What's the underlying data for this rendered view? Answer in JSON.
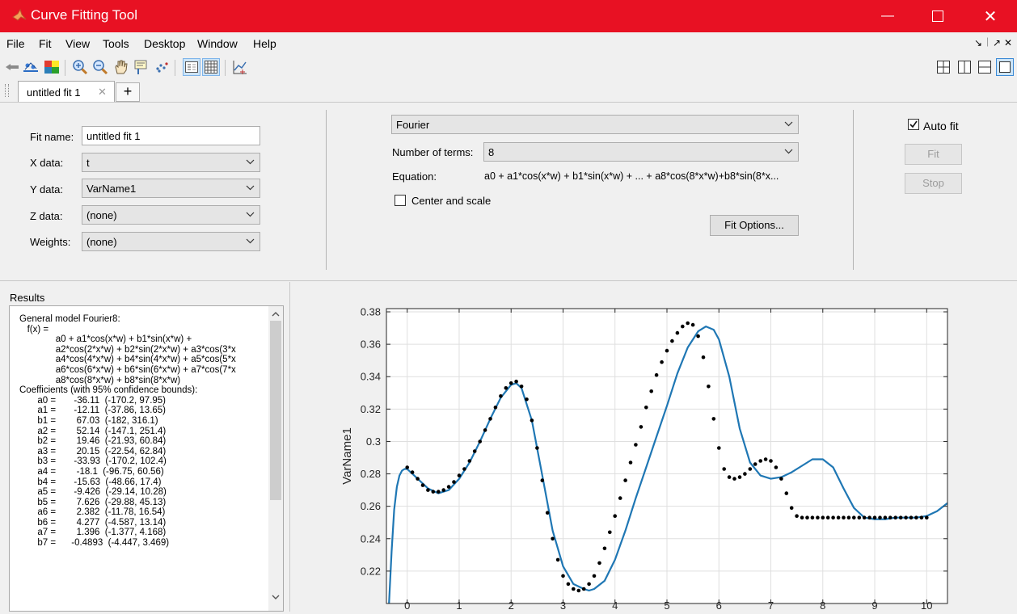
{
  "window": {
    "title": "Curve Fitting Tool"
  },
  "menu": [
    "File",
    "Fit",
    "View",
    "Tools",
    "Desktop",
    "Window",
    "Help"
  ],
  "menu_right": [
    "↘",
    "↗",
    "✕"
  ],
  "tabs": {
    "active": "untitled fit 1",
    "close": "✕",
    "add": "+"
  },
  "fit": {
    "name_label": "Fit name:",
    "name_value": "untitled fit 1",
    "x_label": "X data:",
    "x_value": "t",
    "y_label": "Y data:",
    "y_value": "VarName1",
    "z_label": "Z data:",
    "z_value": "(none)",
    "w_label": "Weights:",
    "w_value": "(none)"
  },
  "model": {
    "type": "Fourier",
    "terms_label": "Number of terms:",
    "terms_value": "8",
    "equation_label": "Equation:",
    "equation": "a0 + a1*cos(x*w) + b1*sin(x*w) + ... + a8*cos(8*x*w)+b8*sin(8*x...",
    "center_scale": "Center and scale",
    "fit_options": "Fit Options..."
  },
  "actions": {
    "auto_fit": "Auto fit",
    "fit": "Fit",
    "stop": "Stop"
  },
  "results": {
    "title": "Results",
    "lines": [
      "General model Fourier8:",
      "   f(x) =",
      "              a0 + a1*cos(x*w) + b1*sin(x*w) +",
      "              a2*cos(2*x*w) + b2*sin(2*x*w) + a3*cos(3*x",
      "              a4*cos(4*x*w) + b4*sin(4*x*w) + a5*cos(5*x",
      "              a6*cos(6*x*w) + b6*sin(6*x*w) + a7*cos(7*x",
      "              a8*cos(8*x*w) + b8*sin(8*x*w)",
      "Coefficients (with 95% confidence bounds):",
      "       a0 =       -36.11  (-170.2, 97.95)",
      "       a1 =       -12.11  (-37.86, 13.65)",
      "       b1 =        67.03  (-182, 316.1)",
      "       a2 =        52.14  (-147.1, 251.4)",
      "       b2 =        19.46  (-21.93, 60.84)",
      "       a3 =        20.15  (-22.54, 62.84)",
      "       b3 =       -33.93  (-170.2, 102.4)",
      "       a4 =        -18.1  (-96.75, 60.56)",
      "       b4 =       -15.63  (-48.66, 17.4)",
      "       a5 =       -9.426  (-29.14, 10.28)",
      "       b5 =        7.626  (-29.88, 45.13)",
      "       a6 =        2.382  (-11.78, 16.54)",
      "       b6 =        4.277  (-4.587, 13.14)",
      "       a7 =        1.396  (-1.377, 4.168)",
      "       b7 =      -0.4893  (-4.447, 3.469)"
    ]
  },
  "colors": {
    "titlebar": "#e81123",
    "fit_line": "#1f77b4",
    "points": "#000000"
  },
  "chart_data": {
    "type": "scatter",
    "title": "",
    "xlabel": "",
    "ylabel": "VarName1",
    "xlim": [
      -0.4,
      10.4
    ],
    "ylim": [
      0.2,
      0.382
    ],
    "xticks": [
      0,
      1,
      2,
      3,
      4,
      5,
      6,
      7,
      8,
      9,
      10
    ],
    "yticks": [
      0.22,
      0.24,
      0.26,
      0.28,
      0.3,
      0.32,
      0.34,
      0.36,
      0.38
    ],
    "grid": true,
    "series": [
      {
        "style": "markers",
        "x": [
          0.0,
          0.1,
          0.2,
          0.3,
          0.4,
          0.5,
          0.6,
          0.7,
          0.8,
          0.9,
          1.0,
          1.1,
          1.2,
          1.3,
          1.4,
          1.5,
          1.6,
          1.7,
          1.8,
          1.9,
          2.0,
          2.1,
          2.2,
          2.3,
          2.4,
          2.5,
          2.6,
          2.7,
          2.8,
          2.9,
          3.0,
          3.1,
          3.2,
          3.3,
          3.4,
          3.5,
          3.6,
          3.7,
          3.8,
          3.9,
          4.0,
          4.1,
          4.2,
          4.3,
          4.4,
          4.5,
          4.6,
          4.7,
          4.8,
          4.9,
          5.0,
          5.1,
          5.2,
          5.3,
          5.4,
          5.5,
          5.6,
          5.7,
          5.8,
          5.9,
          6.0,
          6.1,
          6.2,
          6.3,
          6.4,
          6.5,
          6.6,
          6.7,
          6.8,
          6.9,
          7.0,
          7.1,
          7.2,
          7.3,
          7.4,
          7.5,
          7.6,
          7.7,
          7.8,
          7.9,
          8.0,
          8.1,
          8.2,
          8.3,
          8.4,
          8.5,
          8.6,
          8.7,
          8.8,
          8.9,
          9.0,
          9.1,
          9.2,
          9.3,
          9.4,
          9.5,
          9.6,
          9.7,
          9.8,
          9.9,
          10.0
        ],
        "y": [
          0.284,
          0.281,
          0.277,
          0.273,
          0.27,
          0.269,
          0.269,
          0.27,
          0.272,
          0.275,
          0.279,
          0.283,
          0.288,
          0.294,
          0.3,
          0.307,
          0.314,
          0.321,
          0.328,
          0.333,
          0.336,
          0.337,
          0.334,
          0.326,
          0.313,
          0.296,
          0.276,
          0.256,
          0.24,
          0.227,
          0.217,
          0.212,
          0.209,
          0.208,
          0.209,
          0.212,
          0.217,
          0.225,
          0.234,
          0.244,
          0.254,
          0.265,
          0.276,
          0.287,
          0.298,
          0.309,
          0.321,
          0.331,
          0.341,
          0.349,
          0.356,
          0.362,
          0.367,
          0.371,
          0.373,
          0.372,
          0.365,
          0.352,
          0.334,
          0.314,
          0.296,
          0.283,
          0.278,
          0.277,
          0.278,
          0.28,
          0.283,
          0.286,
          0.288,
          0.289,
          0.288,
          0.284,
          0.277,
          0.268,
          0.259,
          0.254,
          0.253,
          0.253,
          0.253,
          0.253,
          0.253,
          0.253,
          0.253,
          0.253,
          0.253,
          0.253,
          0.253,
          0.253,
          0.253,
          0.253,
          0.253,
          0.253,
          0.253,
          0.253,
          0.253,
          0.253,
          0.253,
          0.253,
          0.253,
          0.253,
          0.253
        ]
      },
      {
        "style": "line",
        "x": [
          -0.35,
          -0.3,
          -0.25,
          -0.2,
          -0.15,
          -0.1,
          -0.05,
          0.0,
          0.2,
          0.4,
          0.6,
          0.8,
          1.0,
          1.2,
          1.4,
          1.6,
          1.8,
          2.0,
          2.1,
          2.2,
          2.4,
          2.6,
          2.8,
          3.0,
          3.2,
          3.4,
          3.5,
          3.6,
          3.8,
          4.0,
          4.2,
          4.4,
          4.6,
          4.8,
          5.0,
          5.2,
          5.4,
          5.6,
          5.75,
          5.9,
          6.0,
          6.2,
          6.4,
          6.6,
          6.8,
          7.0,
          7.2,
          7.4,
          7.6,
          7.8,
          8.0,
          8.2,
          8.4,
          8.6,
          8.8,
          9.0,
          9.2,
          9.4,
          9.6,
          9.8,
          10.0,
          10.2,
          10.4
        ],
        "y": [
          0.2,
          0.232,
          0.258,
          0.272,
          0.279,
          0.282,
          0.283,
          0.283,
          0.277,
          0.271,
          0.268,
          0.27,
          0.277,
          0.287,
          0.3,
          0.314,
          0.327,
          0.335,
          0.336,
          0.333,
          0.313,
          0.279,
          0.245,
          0.223,
          0.212,
          0.209,
          0.208,
          0.209,
          0.214,
          0.227,
          0.245,
          0.265,
          0.284,
          0.303,
          0.322,
          0.342,
          0.358,
          0.368,
          0.371,
          0.369,
          0.363,
          0.34,
          0.308,
          0.287,
          0.279,
          0.277,
          0.278,
          0.281,
          0.285,
          0.289,
          0.289,
          0.284,
          0.271,
          0.259,
          0.253,
          0.252,
          0.252,
          0.253,
          0.253,
          0.253,
          0.254,
          0.257,
          0.262
        ]
      }
    ]
  }
}
